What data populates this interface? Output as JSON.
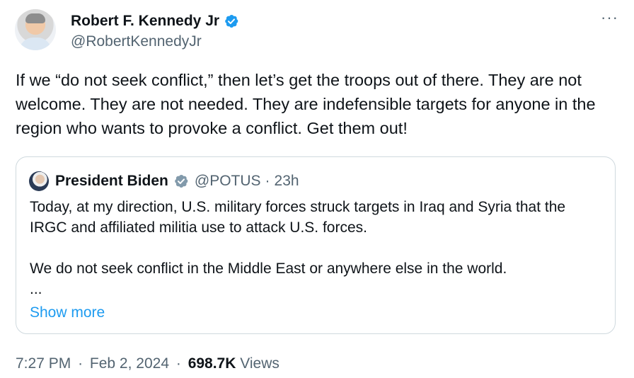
{
  "author": {
    "name": "Robert F. Kennedy Jr",
    "handle": "@RobertKennedyJr"
  },
  "more_label": "···",
  "tweet": {
    "text": "If we “do not seek conflict,” then let’s get the troops out of there. They are not welcome. They are not needed. They are indefensible targets for anyone in the region who wants to provoke a conflict. Get them out!"
  },
  "quote": {
    "name": "President Biden",
    "handle": "@POTUS",
    "separator": "·",
    "time": "23h",
    "text": "Today, at my direction, U.S. military forces struck targets in Iraq and Syria that the IRGC and affiliated militia use to attack U.S. forces.\n\nWe do not seek conflict in the Middle East or anywhere else in the world.\n...",
    "show_more": "Show more"
  },
  "meta": {
    "time": "7:27 PM",
    "separator": "·",
    "date": "Feb 2, 2024",
    "views_count": "698.7K",
    "views_label": "Views"
  },
  "colors": {
    "verified_blue": "#1d9bf0",
    "government_gray": "#829aab",
    "secondary_text": "#536471",
    "link": "#1d9bf0"
  },
  "icons": {
    "author_badge": "verified-badge-icon",
    "quote_badge": "government-badge-icon",
    "more": "more-options-icon"
  }
}
